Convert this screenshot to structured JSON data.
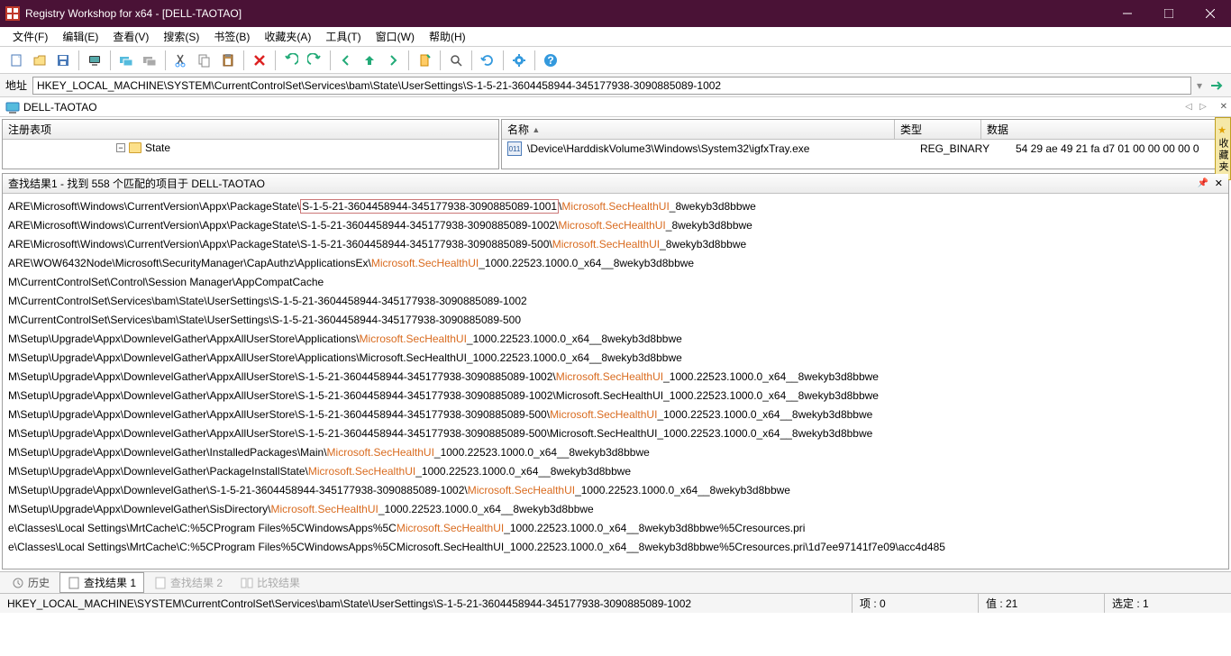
{
  "window": {
    "title": "Registry Workshop for x64 - [DELL-TAOTAO]"
  },
  "menus": [
    "文件(F)",
    "编辑(E)",
    "查看(V)",
    "搜索(S)",
    "书签(B)",
    "收藏夹(A)",
    "工具(T)",
    "窗口(W)",
    "帮助(H)"
  ],
  "address": {
    "label": "地址",
    "value": "HKEY_LOCAL_MACHINE\\SYSTEM\\CurrentControlSet\\Services\\bam\\State\\UserSettings\\S-1-5-21-3604458944-345177938-3090885089-1002"
  },
  "host": "DELL-TAOTAO",
  "favtab": "收藏夹",
  "leftpane": {
    "header": "注册表项",
    "tree_item": "State"
  },
  "rightpane": {
    "columns": {
      "name": "名称",
      "type": "类型",
      "data": "数据"
    },
    "row": {
      "name": "\\Device\\HarddiskVolume3\\Windows\\System32\\igfxTray.exe",
      "type": "REG_BINARY",
      "data": "54 29 ae 49 21 fa d7 01 00 00 00 00 0"
    }
  },
  "results": {
    "header": "查找结果1 - 找到 558 个匹配的项目于 DELL-TAOTAO",
    "lines": [
      {
        "pre": "ARE\\Microsoft\\Windows\\CurrentVersion\\Appx\\PackageState\\",
        "box": "S-1-5-21-3604458944-345177938-3090885089-1001",
        "mid": "\\",
        "hl": "Microsoft.SecHealthUI",
        "post": "_8wekyb3d8bbwe"
      },
      {
        "pre": "ARE\\Microsoft\\Windows\\CurrentVersion\\Appx\\PackageState\\S-1-5-21-3604458944-345177938-3090885089-1002\\",
        "hl": "Microsoft.SecHealthUI",
        "post": "_8wekyb3d8bbwe"
      },
      {
        "pre": "ARE\\Microsoft\\Windows\\CurrentVersion\\Appx\\PackageState\\S-1-5-21-3604458944-345177938-3090885089-500\\",
        "hl": "Microsoft.SecHealthUI",
        "post": "_8wekyb3d8bbwe"
      },
      {
        "pre": "ARE\\WOW6432Node\\Microsoft\\SecurityManager\\CapAuthz\\ApplicationsEx\\",
        "hl": "Microsoft.SecHealthUI",
        "post": "_1000.22523.1000.0_x64__8wekyb3d8bbwe"
      },
      {
        "pre": "M\\CurrentControlSet\\Control\\Session Manager\\AppCompatCache"
      },
      {
        "pre": "M\\CurrentControlSet\\Services\\bam\\State\\UserSettings\\S-1-5-21-3604458944-345177938-3090885089-1002"
      },
      {
        "pre": "M\\CurrentControlSet\\Services\\bam\\State\\UserSettings\\S-1-5-21-3604458944-345177938-3090885089-500"
      },
      {
        "pre": "M\\Setup\\Upgrade\\Appx\\DownlevelGather\\AppxAllUserStore\\Applications\\",
        "hl": "Microsoft.SecHealthUI",
        "post": "_1000.22523.1000.0_x64__8wekyb3d8bbwe"
      },
      {
        "pre": "M\\Setup\\Upgrade\\Appx\\DownlevelGather\\AppxAllUserStore\\Applications\\Microsoft.SecHealthUI_1000.22523.1000.0_x64__8wekyb3d8bbwe"
      },
      {
        "pre": "M\\Setup\\Upgrade\\Appx\\DownlevelGather\\AppxAllUserStore\\S-1-5-21-3604458944-345177938-3090885089-1002\\",
        "hl": "Microsoft.SecHealthUI",
        "post": "_1000.22523.1000.0_x64__8wekyb3d8bbwe"
      },
      {
        "pre": "M\\Setup\\Upgrade\\Appx\\DownlevelGather\\AppxAllUserStore\\S-1-5-21-3604458944-345177938-3090885089-1002\\Microsoft.SecHealthUI_1000.22523.1000.0_x64__8wekyb3d8bbwe"
      },
      {
        "pre": "M\\Setup\\Upgrade\\Appx\\DownlevelGather\\AppxAllUserStore\\S-1-5-21-3604458944-345177938-3090885089-500\\",
        "hl": "Microsoft.SecHealthUI",
        "post": "_1000.22523.1000.0_x64__8wekyb3d8bbwe"
      },
      {
        "pre": "M\\Setup\\Upgrade\\Appx\\DownlevelGather\\AppxAllUserStore\\S-1-5-21-3604458944-345177938-3090885089-500\\Microsoft.SecHealthUI_1000.22523.1000.0_x64__8wekyb3d8bbwe"
      },
      {
        "pre": "M\\Setup\\Upgrade\\Appx\\DownlevelGather\\InstalledPackages\\Main\\",
        "hl": "Microsoft.SecHealthUI",
        "post": "_1000.22523.1000.0_x64__8wekyb3d8bbwe"
      },
      {
        "pre": "M\\Setup\\Upgrade\\Appx\\DownlevelGather\\PackageInstallState\\",
        "hl": "Microsoft.SecHealthUI",
        "post": "_1000.22523.1000.0_x64__8wekyb3d8bbwe"
      },
      {
        "pre": "M\\Setup\\Upgrade\\Appx\\DownlevelGather\\S-1-5-21-3604458944-345177938-3090885089-1002\\",
        "hl": "Microsoft.SecHealthUI",
        "post": "_1000.22523.1000.0_x64__8wekyb3d8bbwe"
      },
      {
        "pre": "M\\Setup\\Upgrade\\Appx\\DownlevelGather\\SisDirectory\\",
        "hl": "Microsoft.SecHealthUI",
        "post": "_1000.22523.1000.0_x64__8wekyb3d8bbwe"
      },
      {
        "pre": "e\\Classes\\Local Settings\\MrtCache\\C:%5CProgram Files%5CWindowsApps%5C",
        "hl": "Microsoft.SecHealthUI",
        "post": "_1000.22523.1000.0_x64__8wekyb3d8bbwe%5Cresources.pri"
      },
      {
        "pre": "e\\Classes\\Local Settings\\MrtCache\\C:%5CProgram Files%5CWindowsApps%5CMicrosoft.SecHealthUI_1000.22523.1000.0_x64__8wekyb3d8bbwe%5Cresources.pri\\1d7ee97141f7e09\\acc4d485"
      }
    ]
  },
  "tabs": {
    "history": "历史",
    "r1": "查找结果 1",
    "r2": "查找结果 2",
    "cmp": "比较结果"
  },
  "status": {
    "path": "HKEY_LOCAL_MACHINE\\SYSTEM\\CurrentControlSet\\Services\\bam\\State\\UserSettings\\S-1-5-21-3604458944-345177938-3090885089-1002",
    "items": "项 : 0",
    "values": "值 : 21",
    "sel": "选定 : 1"
  }
}
